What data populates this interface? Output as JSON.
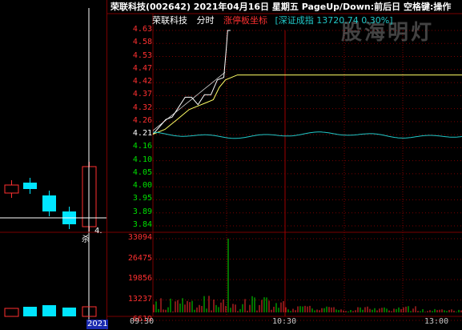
{
  "title": {
    "text": "荣联科技(002642)  2021年04月16日  星期五  PageUp/Down:前后日  空格键:操作"
  },
  "watermark": "股海明灯",
  "sub_header": {
    "stock": "荣联科技",
    "mode": "分时",
    "limit": "涨停板坐标",
    "index": "[深证成指 13720.74 0.30%]"
  },
  "price_axis": [
    "4.63",
    "4.58",
    "4.53",
    "4.47",
    "4.42",
    "4.37",
    "4.32",
    "4.26",
    "4.21",
    "4.16",
    "4.10",
    "4.05",
    "4.00",
    "3.95",
    "3.89",
    "3.84"
  ],
  "volume_axis": [
    "33094",
    "26475",
    "19856",
    "13237",
    "6619"
  ],
  "time_axis": [
    "09:30",
    "10:30",
    "13:00"
  ],
  "left_panel": {
    "note": "4.",
    "mark": "杀",
    "date": "2021"
  },
  "colors": {
    "up": "#ff3030",
    "down": "#00e5ff",
    "price_line": "#ffffff",
    "avg_line": "#ffff66",
    "index_line": "#20c8c8",
    "grid": "#7a0000"
  },
  "chart_data": {
    "type": "line",
    "title": "",
    "x_range": [
      "09:30",
      "15:00"
    ],
    "ylim": [
      3.84,
      4.63
    ],
    "reference_price": 4.21,
    "series": [
      {
        "name": "price",
        "x": [
          "09:30",
          "09:35",
          "09:40",
          "09:45",
          "09:50",
          "09:55",
          "10:00",
          "10:05",
          "10:10",
          "10:15",
          "10:20",
          "10:25",
          "10:27",
          "10:28",
          "10:29"
        ],
        "values": [
          4.21,
          4.24,
          4.27,
          4.28,
          4.32,
          4.36,
          4.36,
          4.33,
          4.37,
          4.37,
          4.43,
          4.44,
          4.56,
          4.63,
          4.63
        ]
      },
      {
        "values": [
          4.21,
          4.22,
          4.23,
          4.25,
          4.27,
          4.29,
          4.31,
          4.32,
          4.33,
          4.34,
          4.35,
          4.4,
          4.43,
          4.44,
          4.45,
          4.45,
          4.45
        ]
      }
    ],
    "volume": {
      "ylim": [
        0,
        33094
      ],
      "peak": 33094,
      "peak_time": "10:28"
    }
  }
}
